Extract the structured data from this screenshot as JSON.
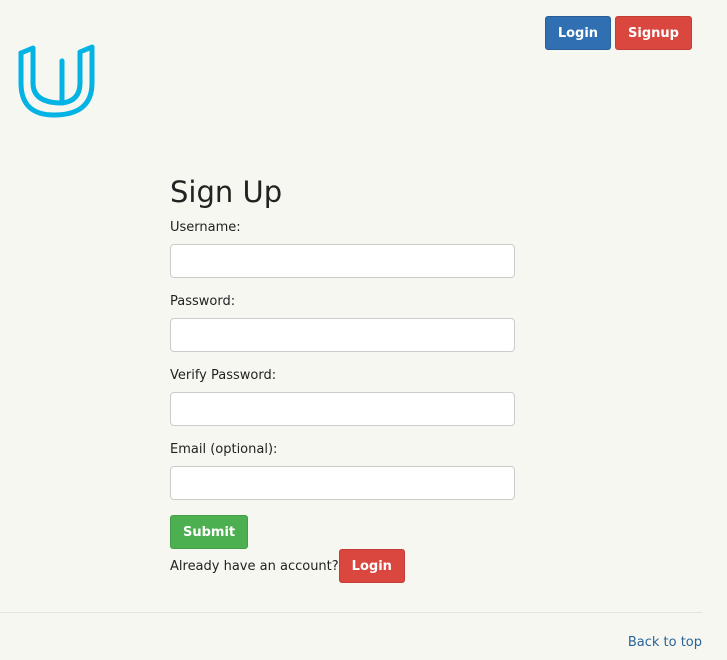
{
  "nav": {
    "login_label": "Login",
    "signup_label": "Signup"
  },
  "logo": {
    "icon": "udacity-u-logo",
    "color": "#02b3e4"
  },
  "form": {
    "title": "Sign Up",
    "fields": [
      {
        "label": "Username:",
        "value": "",
        "type": "text"
      },
      {
        "label": "Password:",
        "value": "",
        "type": "password"
      },
      {
        "label": "Verify Password:",
        "value": "",
        "type": "password"
      },
      {
        "label": "Email (optional):",
        "value": "",
        "type": "email"
      }
    ],
    "submit_label": "Submit"
  },
  "account_prompt": {
    "text": "Already have an account?",
    "login_label": "Login"
  },
  "footer": {
    "back_to_top": "Back to top"
  },
  "colors": {
    "background": "#f7f7f2",
    "primary": "#2f6fb2",
    "danger": "#d9473f",
    "success": "#4caf50",
    "link": "#2a6496"
  }
}
